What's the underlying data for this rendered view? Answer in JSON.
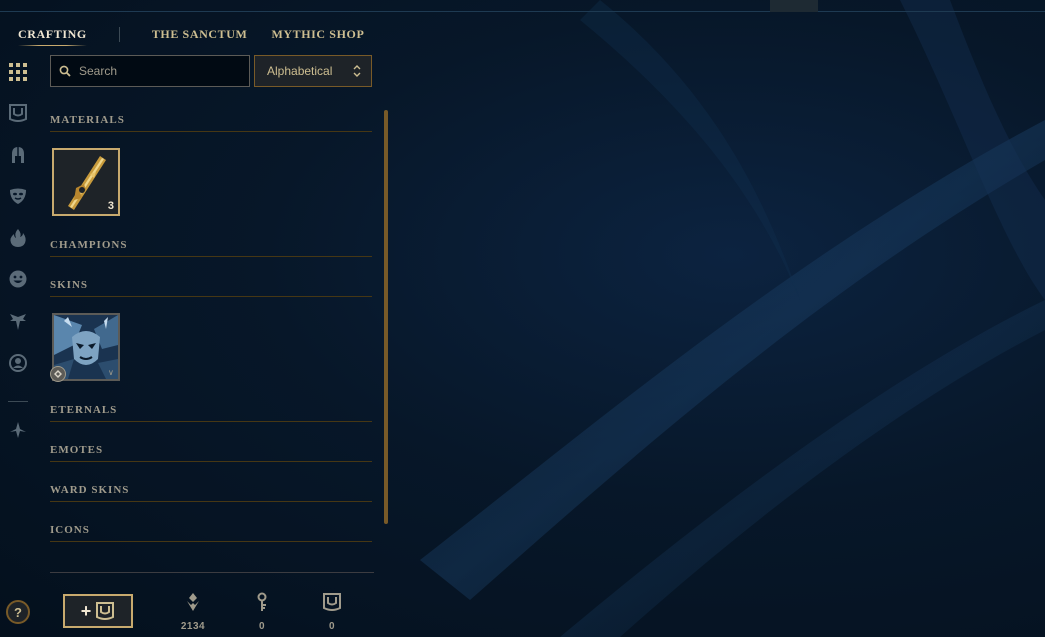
{
  "tabs": {
    "crafting": "CRAFTING",
    "sanctum": "THE SANCTUM",
    "mythic_shop": "MYTHIC SHOP"
  },
  "rail_icons": [
    "grid-icon",
    "chest-icon",
    "helmet-icon",
    "mask-icon",
    "flame-icon",
    "emote-face-icon",
    "ward-icon",
    "profile-icon",
    "tft-icon"
  ],
  "search": {
    "placeholder": "Search",
    "value": ""
  },
  "sort": {
    "selected": "Alphabetical"
  },
  "sections": {
    "materials": "MATERIALS",
    "champions": "CHAMPIONS",
    "skins": "SKINS",
    "eternals": "ETERNALS",
    "emotes": "EMOTES",
    "ward_skins": "WARD SKINS",
    "icons": "ICONS"
  },
  "materials": [
    {
      "icon": "key-fragment-icon",
      "count": "3"
    }
  ],
  "skins": [
    {
      "icon": "skin-shard-icon",
      "badge": "hextech-badge-icon"
    }
  ],
  "footer": {
    "help": "?",
    "add_label": "+",
    "currencies": [
      {
        "icon": "orange-essence-icon",
        "value": "2134"
      },
      {
        "icon": "key-icon",
        "value": "0"
      },
      {
        "icon": "chest-icon",
        "value": "0"
      }
    ]
  },
  "colors": {
    "gold": "#c8aa6e",
    "gold_dark": "#785a28",
    "text": "#a09b8c",
    "text_light": "#f0e6d2",
    "background": "#071729"
  }
}
